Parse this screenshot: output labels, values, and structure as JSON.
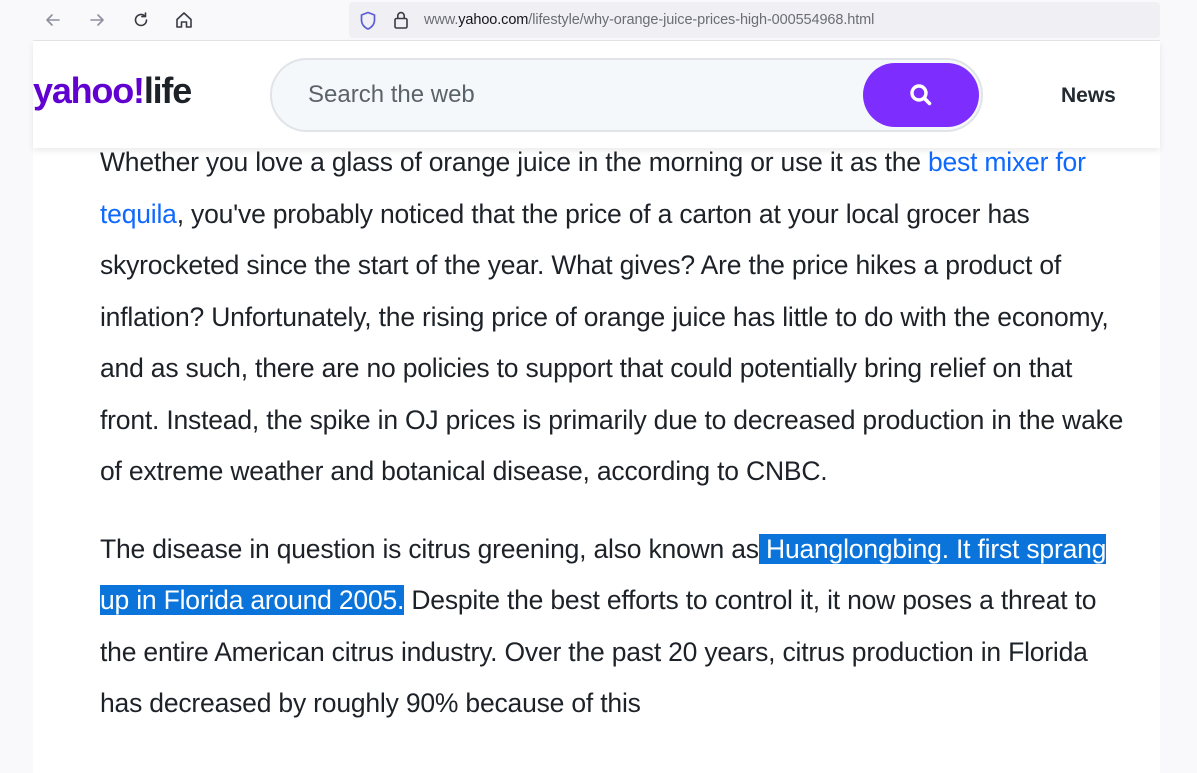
{
  "browser": {
    "url_prefix": "www.",
    "url_domain": "yahoo.com",
    "url_path": "/lifestyle/why-orange-juice-prices-high-000554968.html",
    "back_icon": "arrow-left-icon",
    "forward_icon": "arrow-right-icon",
    "reload_icon": "reload-icon",
    "home_icon": "home-icon",
    "shield_icon": "shield-icon",
    "lock_icon": "lock-icon"
  },
  "header": {
    "logo_yahoo": "yahoo",
    "logo_mark": "!",
    "logo_life": "life",
    "search_placeholder": "Search the web",
    "search_icon": "search-icon",
    "nav_news": "News",
    "brand_color": "#6001d2",
    "search_button_color": "#7d2eff"
  },
  "article": {
    "p1_before_link": "Whether you love a glass of orange juice in the morning or use it as the ",
    "p1_link": "best mixer for tequila",
    "p1_after_link": ", you've probably noticed that the price of a carton at your local grocer has skyrocketed since the start of the year. What gives? Are the price hikes a product of inflation? Unfortunately, the rising price of orange juice has little to do with the economy, and as such, there are no policies to support that could potentially bring relief on that front. Instead, the spike in OJ prices is primarily due to decreased production in the wake of extreme weather and botanical disease, according to CNBC.",
    "p2_before_highlight": "The disease in question is citrus greening, also known as",
    "p2_highlight": " Huanglongbing. It first sprang up in Florida around 2005.",
    "p2_after_highlight": " Despite the best efforts to control it, it now poses a threat to the entire American citrus industry. Over the past 20 years, citrus production in Florida has decreased by roughly 90% because of this",
    "link_color": "#0f69ff",
    "highlight_color": "#0a74da"
  }
}
